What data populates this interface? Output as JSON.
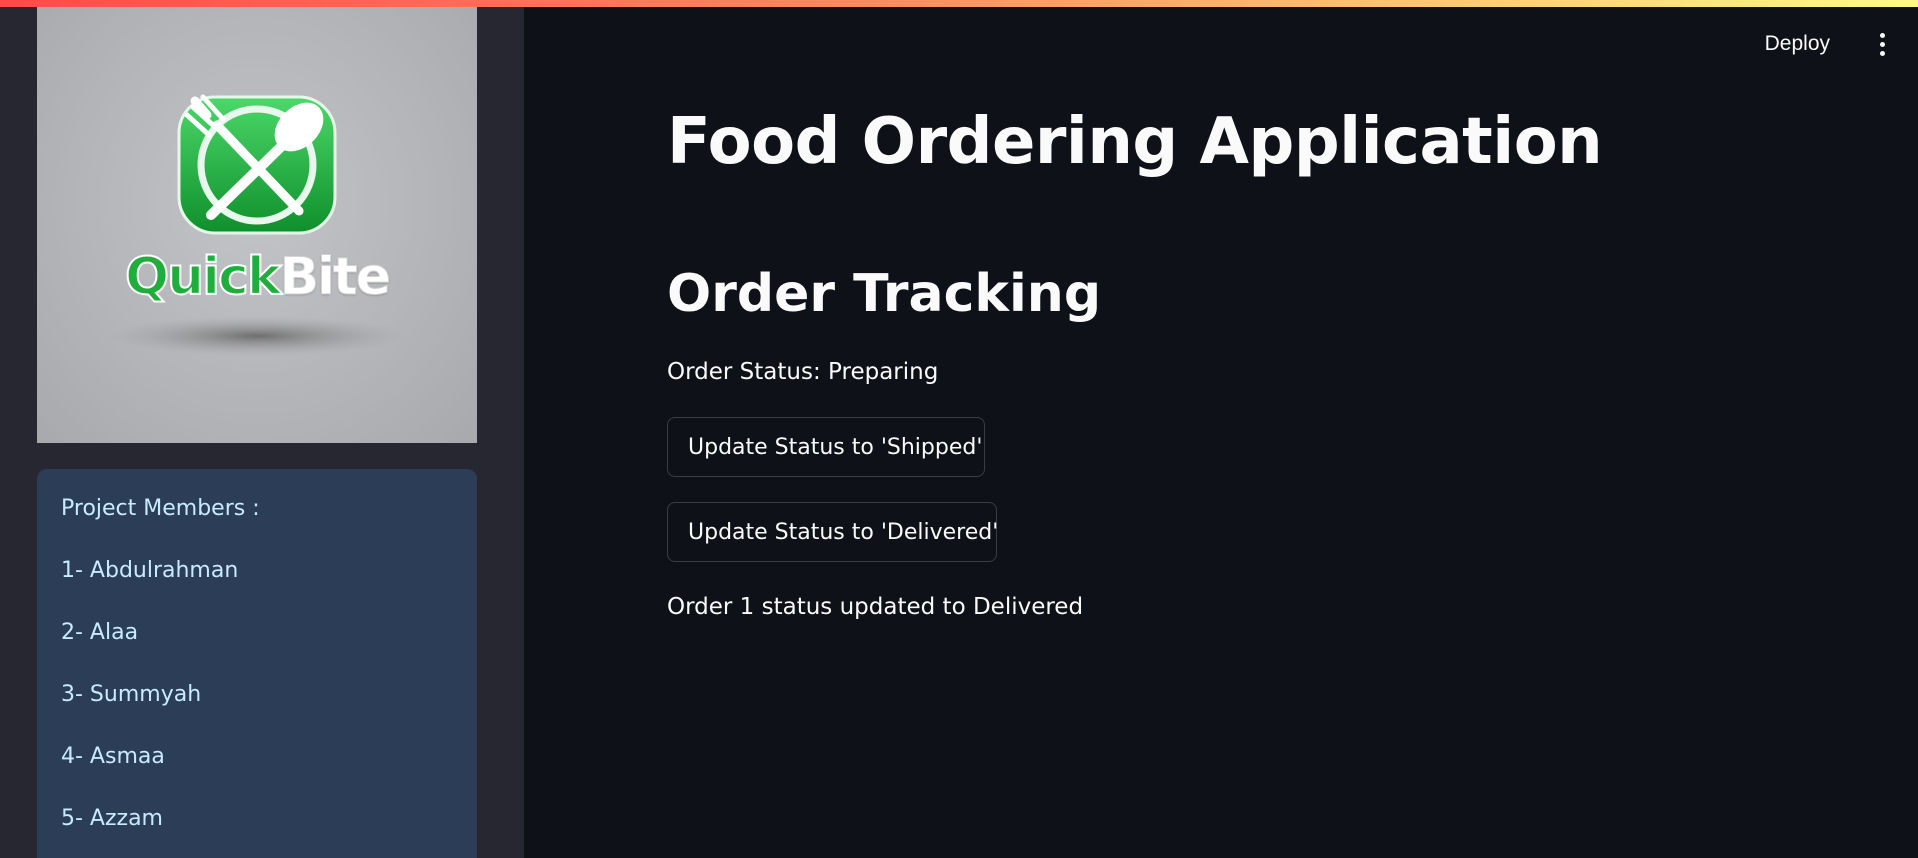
{
  "header": {
    "deploy_label": "Deploy",
    "menu_icon": "kebab-menu-icon"
  },
  "sidebar": {
    "logo": {
      "text_part1": "Quick",
      "text_part2": "Bite",
      "icon": "fork-spoon-icon",
      "colors": {
        "green": "#1fae3c",
        "background": "#b5b6ba"
      }
    },
    "members": {
      "heading": "Project Members :",
      "items": [
        {
          "label": "1- Abdulrahman"
        },
        {
          "label": "2- Alaa"
        },
        {
          "label": "3- Summyah"
        },
        {
          "label": "4- Asmaa"
        },
        {
          "label": "5- Azzam"
        }
      ]
    }
  },
  "main": {
    "title": "Food Ordering Application",
    "section_title": "Order Tracking",
    "status_text": "Order Status: Preparing",
    "buttons": {
      "shipped": "Update Status to 'Shipped'",
      "delivered": "Update Status to 'Delivered'"
    },
    "result_text": "Order 1 status updated to Delivered"
  },
  "colors": {
    "background": "#0e1117",
    "sidebar": "#262730",
    "members_box": "#2c3e57",
    "members_text": "#c7ebff",
    "accent_gradient_start": "#ff4b4b",
    "accent_gradient_end": "#fffd80"
  }
}
